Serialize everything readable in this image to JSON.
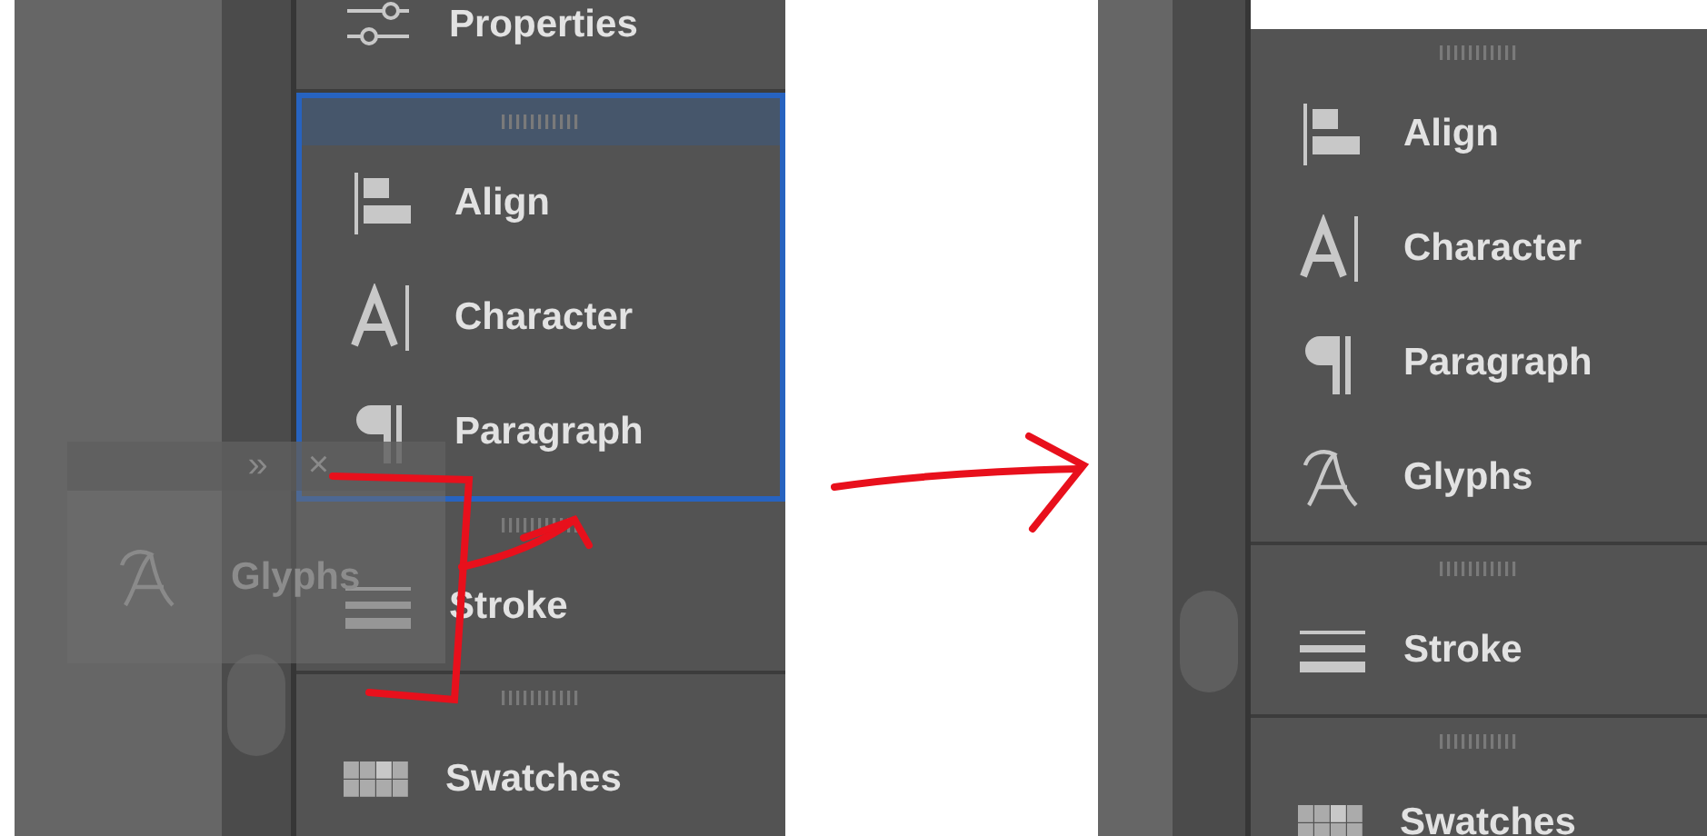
{
  "before": {
    "groups": [
      {
        "highlighted": false,
        "items": [
          {
            "kind": "properties",
            "label": "Properties"
          }
        ]
      },
      {
        "highlighted": true,
        "items": [
          {
            "kind": "align",
            "label": "Align"
          },
          {
            "kind": "character",
            "label": "Character"
          },
          {
            "kind": "paragraph",
            "label": "Paragraph"
          }
        ]
      },
      {
        "highlighted": false,
        "items": [
          {
            "kind": "stroke",
            "label": "Stroke"
          }
        ]
      },
      {
        "highlighted": false,
        "items": [
          {
            "kind": "swatches",
            "label": "Swatches"
          }
        ]
      }
    ],
    "floating_panel": {
      "header_buttons": [
        "»",
        "×"
      ],
      "items": [
        {
          "kind": "glyphs",
          "label": "Glyphs"
        }
      ]
    }
  },
  "after": {
    "groups": [
      {
        "highlighted": false,
        "items": [
          {
            "kind": "align",
            "label": "Align"
          },
          {
            "kind": "character",
            "label": "Character"
          },
          {
            "kind": "paragraph",
            "label": "Paragraph"
          },
          {
            "kind": "glyphs",
            "label": "Glyphs"
          }
        ]
      },
      {
        "highlighted": false,
        "items": [
          {
            "kind": "stroke",
            "label": "Stroke"
          }
        ]
      },
      {
        "highlighted": false,
        "items": [
          {
            "kind": "swatches",
            "label": "Swatches"
          }
        ]
      }
    ]
  }
}
